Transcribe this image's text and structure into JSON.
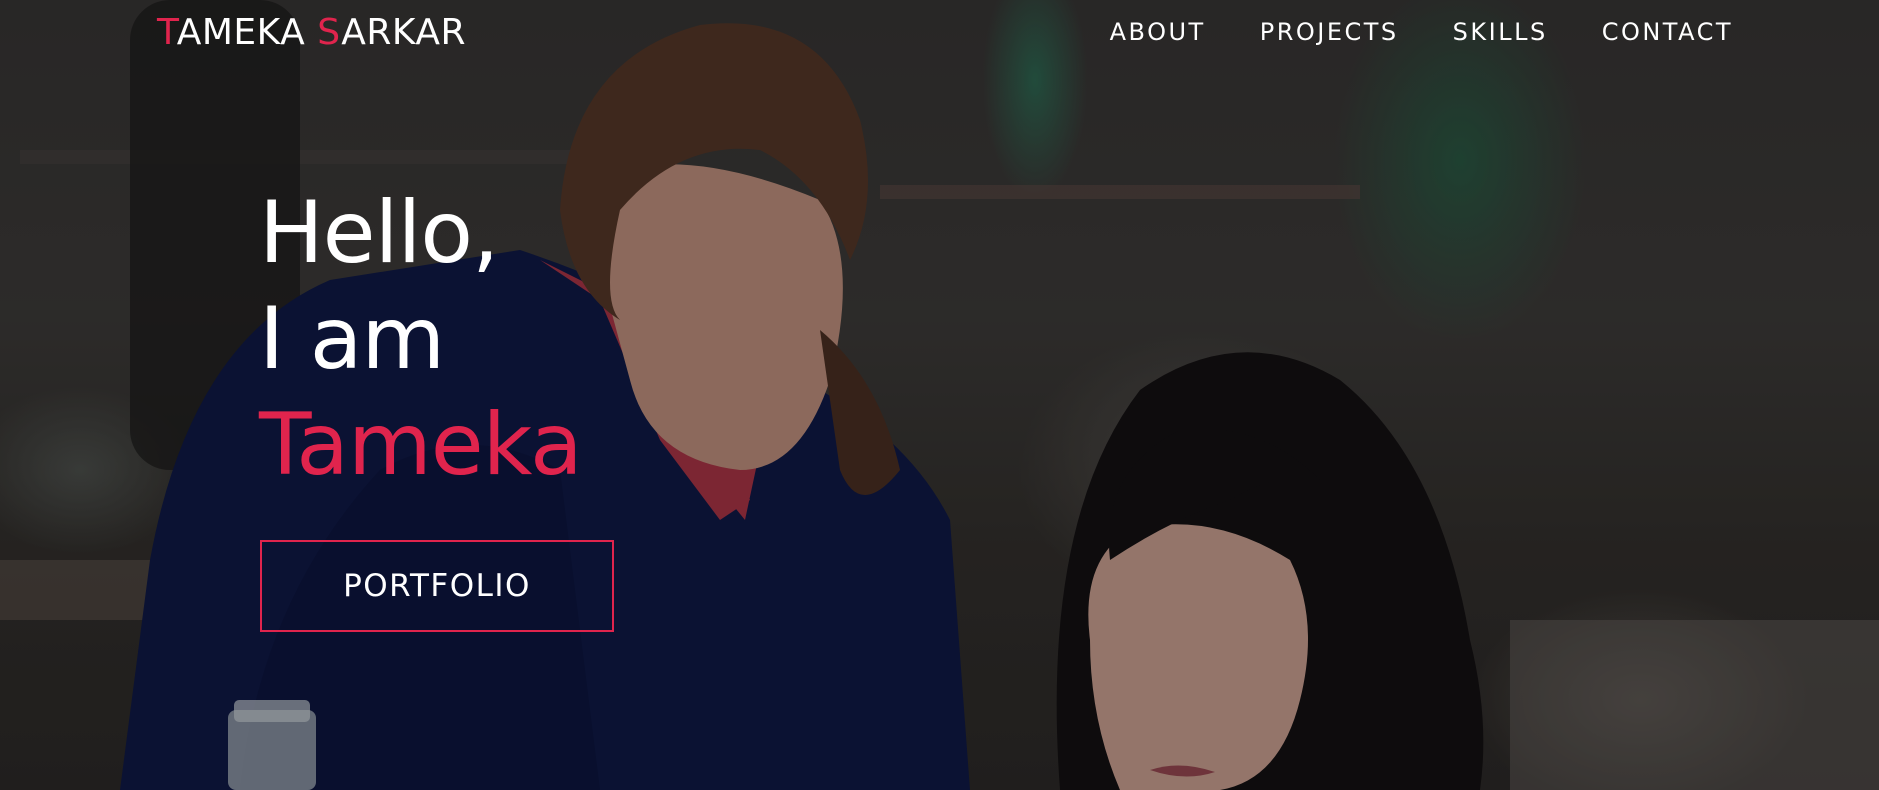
{
  "header": {
    "logo": {
      "first_initial": "T",
      "first_rest": "AMEKA ",
      "last_initial": "S",
      "last_rest": "ARKAR"
    },
    "nav": [
      {
        "label": "ABOUT"
      },
      {
        "label": "PROJECTS"
      },
      {
        "label": "SKILLS"
      },
      {
        "label": "CONTACT"
      }
    ]
  },
  "hero": {
    "line1": "Hello,",
    "line2": "I am",
    "name": "Tameka",
    "cta_label": "PORTFOLIO",
    "background_icon": "photo-two-women-working"
  },
  "colors": {
    "accent": "#e0244d",
    "text": "#ffffff",
    "overlay": "rgba(0,0,0,0.30)"
  }
}
